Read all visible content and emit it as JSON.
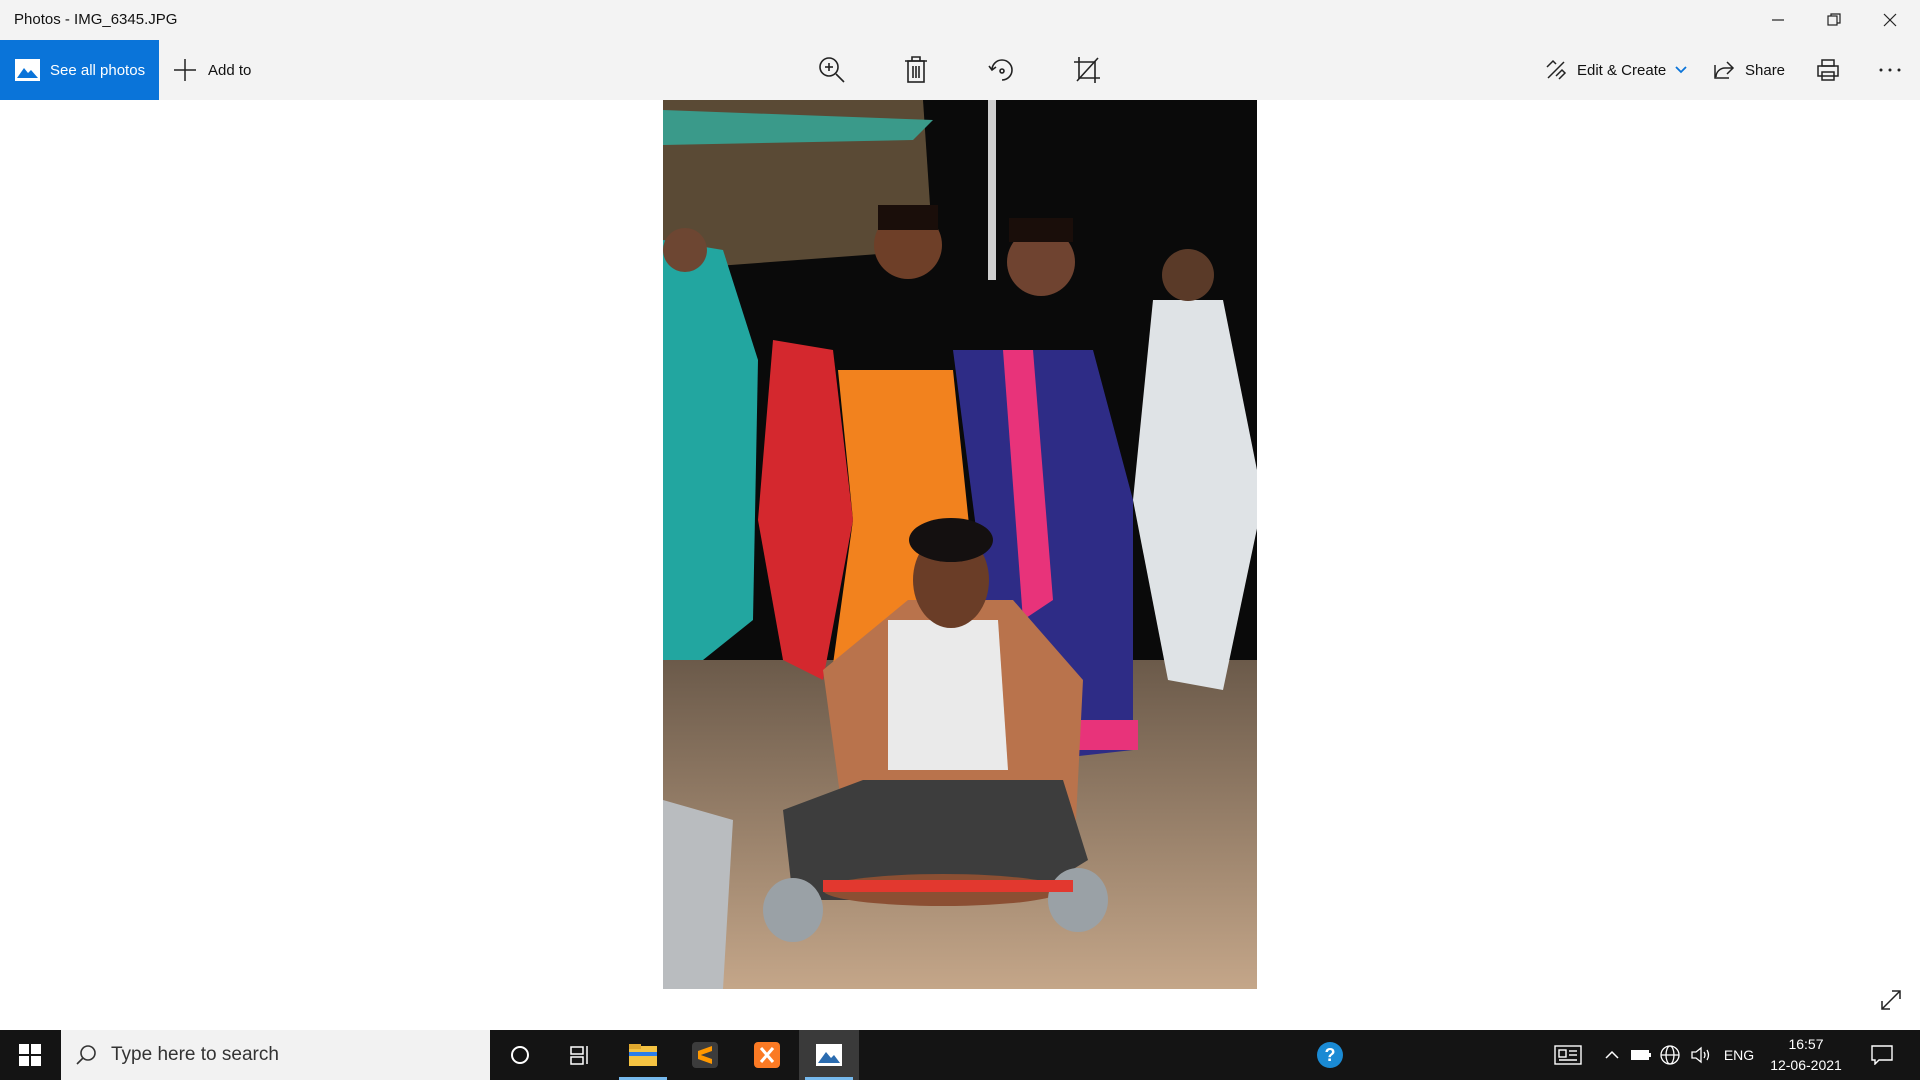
{
  "window": {
    "title": "Photos - IMG_6345.JPG",
    "controls": [
      "minimize-icon",
      "restore-icon",
      "close-icon"
    ]
  },
  "toolbar": {
    "see_all_photos": "See all photos",
    "add_to": "Add to",
    "center_tools": [
      "zoom-in-icon",
      "delete-icon",
      "rotate-icon",
      "crop-icon"
    ],
    "edit_create": "Edit & Create",
    "share": "Share",
    "print_icon": "print-icon",
    "more_icon": "more-icon"
  },
  "viewer": {
    "photo_subject": "photo",
    "expand_icon": "expand-icon"
  },
  "taskbar": {
    "search_placeholder": "Type here to search",
    "apps": [
      "start-icon",
      "cortana-icon",
      "task-view-icon",
      "file-explorer-icon",
      "sublime-text-icon",
      "xampp-icon",
      "photos-icon"
    ],
    "help_icon": "help-icon",
    "tray": {
      "language": "ENG",
      "time": "16:57",
      "date": "12-06-2021"
    }
  },
  "colors": {
    "accent": "#0a74d9",
    "toolbar_bg": "#f3f3f3",
    "taskbar_bg": "#141414"
  }
}
